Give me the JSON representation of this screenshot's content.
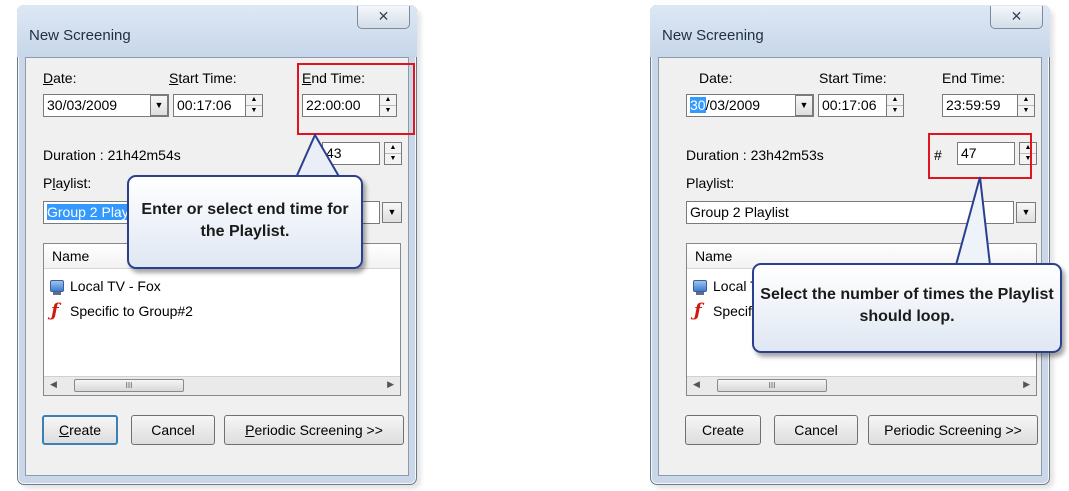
{
  "dialogs": [
    {
      "title": "New Screening",
      "close_glyph": "✕",
      "date_label_underline": "D",
      "date_label_rest": "ate:",
      "start_label_underline": "S",
      "start_label_rest": "tart Time:",
      "end_label_underline": "E",
      "end_label_rest": "nd Time:",
      "date_value": "30/03/2009",
      "start_value": "00:17:06",
      "end_value": "22:00:00",
      "duration": "Duration : 21h42m54s",
      "loops_prefix": "",
      "loops_value": "43",
      "playlist_label_pre": "P",
      "playlist_label_underline": "l",
      "playlist_label_rest": "aylist:",
      "playlist_value": "Group 2 Playlist",
      "list_header": "Name",
      "items": [
        {
          "icon": "tv-icon",
          "label": "Local TV - Fox"
        },
        {
          "icon": "flash-icon",
          "label": "Specific to Group#2"
        }
      ],
      "scroll_thumb": "III",
      "btn_create_underline": "C",
      "btn_create_rest": "reate",
      "btn_cancel": "Cancel",
      "btn_periodic_underline": "P",
      "btn_periodic_rest": "eriodic Screening >>",
      "callout": "Enter or select end time for the Playlist."
    },
    {
      "title": "New Screening",
      "close_glyph": "✕",
      "date_label": "Date:",
      "start_label": "Start Time:",
      "end_label": "End Time:",
      "date_day": "30",
      "date_rest": "/03/2009",
      "start_value": "00:17:06",
      "end_value": "23:59:59",
      "duration": "Duration : 23h42m53s",
      "loops_prefix": "#",
      "loops_value": "47",
      "playlist_label": "Playlist:",
      "playlist_value": "Group 2 Playlist",
      "list_header": "Name",
      "items": [
        {
          "icon": "tv-icon",
          "label": "Local TV - Fox"
        },
        {
          "icon": "flash-icon",
          "label": "Specific to Group#2"
        }
      ],
      "scroll_thumb": "III",
      "btn_create": "Create",
      "btn_cancel": "Cancel",
      "btn_periodic": "Periodic Screening >>",
      "callout": "Select the number of times the Playlist should loop."
    }
  ],
  "colors": {
    "highlight_box": "#e0141e",
    "callout_border": "#2a3f8f",
    "selection": "#3399ff"
  }
}
